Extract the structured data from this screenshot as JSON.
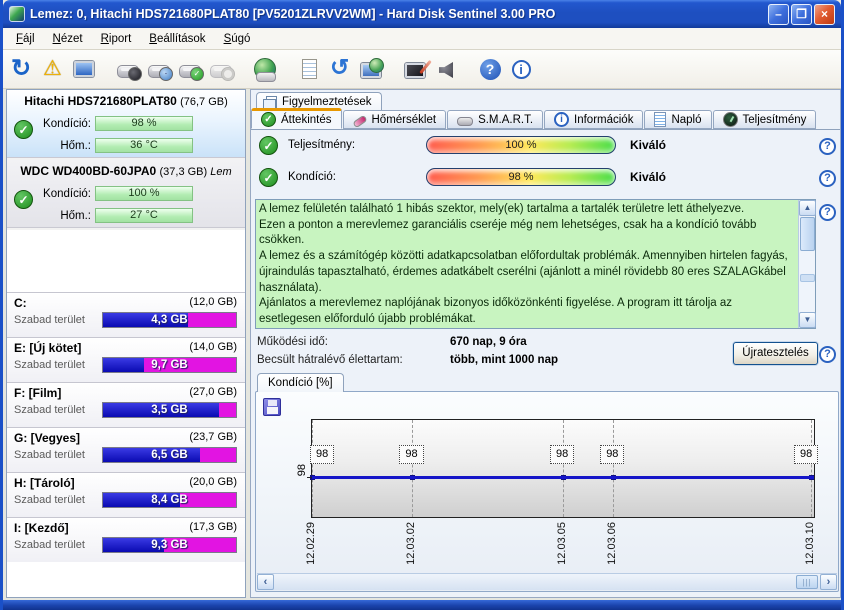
{
  "window": {
    "title": "Lemez: 0, Hitachi HDS721680PLAT80 [PV5201ZLRVV2WM]  -  Hard Disk Sentinel 3.00 PRO",
    "buttons": {
      "minimize": "–",
      "maximize": "❒",
      "close": "×"
    }
  },
  "menu": {
    "items": [
      "Fájl",
      "Nézet",
      "Riport",
      "Beállítások",
      "Súgó"
    ]
  },
  "toolbar": {
    "groups": [
      [
        "refresh-icon",
        "alerts-icon",
        "display-icon"
      ],
      [
        "disk-gauge-icon",
        "disk-clock-icon",
        "disk-ok-icon",
        "disk-search-icon"
      ],
      [
        "world-disk-icon"
      ],
      [
        "report-icon",
        "sync-icon",
        "network-icon"
      ],
      [
        "test-monitor-icon",
        "sound-icon"
      ],
      [
        "help-icon",
        "info-icon"
      ]
    ]
  },
  "sidebar": {
    "condition_label": "Kondíció:",
    "temperature_label": "Hőm.:",
    "free_space_label": "Szabad terület",
    "disks": [
      {
        "name": "Hitachi HDS721680PLAT80",
        "size": "(76,7 GB)",
        "extra": "",
        "condition": "98 %",
        "temperature": "36 °C",
        "selected": true
      },
      {
        "name": "WDC WD400BD-60JPA0",
        "size": "(37,3 GB)",
        "extra": "Lem",
        "condition": "100 %",
        "temperature": "27 °C",
        "selected": false
      }
    ],
    "partitions": [
      {
        "name": "C:",
        "size": "(12,0 GB)",
        "free": "4,3 GB",
        "used_pct": 64
      },
      {
        "name": "E: [Új kötet]",
        "size": "(14,0 GB)",
        "free": "9,7 GB",
        "used_pct": 31
      },
      {
        "name": "F: [Film]",
        "size": "(27,0 GB)",
        "free": "3,5 GB",
        "used_pct": 87
      },
      {
        "name": "G: [Vegyes]",
        "size": "(23,7 GB)",
        "free": "6,5 GB",
        "used_pct": 73
      },
      {
        "name": "H: [Tároló]",
        "size": "(20,0 GB)",
        "free": "8,4 GB",
        "used_pct": 58
      },
      {
        "name": "I: [Kezdő]",
        "size": "(17,3 GB)",
        "free": "9,3 GB",
        "used_pct": 46
      }
    ]
  },
  "main": {
    "alert_tab": "Figyelmeztetések",
    "tabs": [
      {
        "label": "Áttekintés",
        "icon": "ok-icon",
        "active": true
      },
      {
        "label": "Hőmérséklet",
        "icon": "thermo-icon",
        "active": false
      },
      {
        "label": "S.M.A.R.T.",
        "icon": "smart-icon",
        "active": false
      },
      {
        "label": "Információk",
        "icon": "balloon-icon",
        "active": false
      },
      {
        "label": "Napló",
        "icon": "log-icon",
        "active": false
      },
      {
        "label": "Teljesítmény",
        "icon": "perf-icon",
        "active": false
      }
    ],
    "gauges": [
      {
        "label": "Teljesítmény:",
        "value": "100 %",
        "rating": "Kiváló"
      },
      {
        "label": "Kondíció:",
        "value": "98 %",
        "rating": "Kiváló"
      }
    ],
    "message": "A lemez felületén található 1 hibás szektor, mely(ek) tartalma a tartalék területre lett áthelyezve.\nEzen a ponton a merevlemez garanciális cseréje még nem lehetséges, csak ha a kondíció tovább csökken.\nA lemez és a számítógép közötti adatkapcsolatban előfordultak problémák. Amennyiben hirtelen fagyás, újraindulás tapasztalható, érdemes adatkábelt cserélni (ajánlott a minél rövidebb 80 eres SZALAGkábel használata).\nAjánlatos a merevlemez naplójának bizonyos időközönkénti figyelése. A program itt tárolja az esetlegesen előforduló újabb problémákat.",
    "info_rows": [
      {
        "label": "Működési idő:",
        "value": "670 nap, 9 óra"
      },
      {
        "label": "Becsült hátralévő élettartam:",
        "value": "több, mint 1000 nap"
      }
    ],
    "retest_button": "Újratesztelés"
  },
  "chart_data": {
    "type": "line",
    "title": "Kondíció [%]",
    "x": [
      "12.02.29",
      "12.03.02",
      "12.03.05",
      "12.03.06",
      "12.03.10"
    ],
    "values": [
      98,
      98,
      98,
      98,
      98
    ],
    "point_labels": [
      "98",
      "98",
      "98",
      "98",
      "98"
    ],
    "x_positions_pct": [
      0,
      20,
      50,
      60,
      99.5
    ],
    "y_axis_tick": "98",
    "line_color": "#1515C8",
    "grid": "dashed-vertical",
    "legend": "none"
  },
  "colors": {
    "titlebar": "#1E4FC0",
    "active_tab_accent": "#E89800",
    "message_bg": "#C8F4C0",
    "bar_used": "#0A0AB2",
    "bar_free": "#E214E2",
    "green_bar": "#B2ECB2",
    "gauge_gradient": [
      "#FF5B4E",
      "#FFE95A",
      "#4ADE4A"
    ]
  }
}
